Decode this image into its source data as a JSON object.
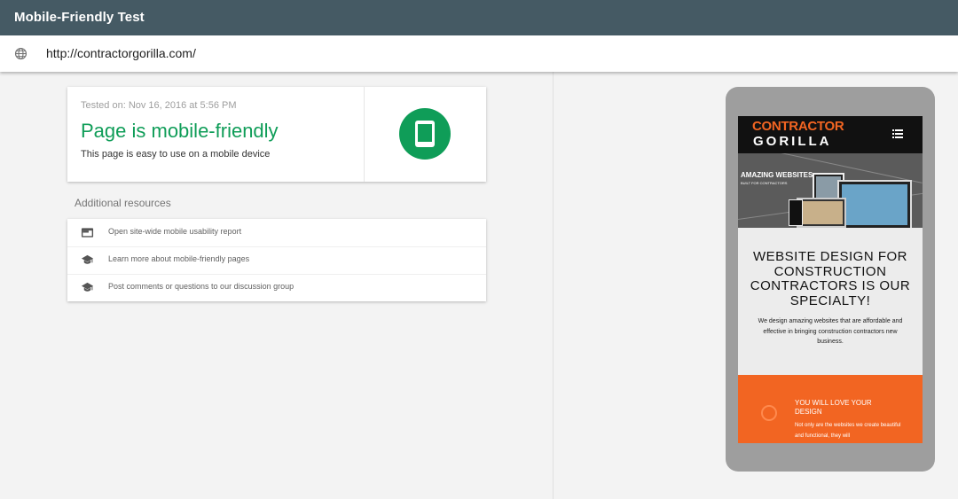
{
  "app": {
    "title": "Mobile-Friendly Test"
  },
  "url_bar": {
    "url": "http://contractorgorilla.com/",
    "icon": "globe-icon"
  },
  "result": {
    "tested_on": "Tested on: Nov 16, 2016 at 5:56 PM",
    "verdict": "Page is mobile-friendly",
    "description": "This page is easy to use on a mobile device",
    "badge_icon": "smartphone-icon",
    "verdict_color": "#0f9d58"
  },
  "resources": {
    "title": "Additional resources",
    "items": [
      {
        "label": "Open site-wide mobile usability report",
        "icon": "web-report-icon"
      },
      {
        "label": "Learn more about mobile-friendly pages",
        "icon": "school-icon"
      },
      {
        "label": "Post comments or questions to our discussion group",
        "icon": "school-icon"
      }
    ]
  },
  "preview": {
    "logo_line1": "CONTRACTOR",
    "logo_line2": "GORILLA",
    "hero_title": "AMAZING WEBSITES",
    "hero_subtitle": "BUILT FOR CONTRACTORS",
    "headline": "WEBSITE DESIGN FOR CONSTRUCTION CONTRACTORS IS OUR SPECIALTY!",
    "body": "We design amazing websites that are affordable and effective in bringing construction contractors new business.",
    "section_title": "YOU WILL LOVE YOUR DESIGN",
    "section_body": "Not only are the websites we create beautiful and functional, they will",
    "accent_color": "#f26522"
  },
  "colors": {
    "topbar": "#455a64",
    "background": "#f3f3f3"
  }
}
